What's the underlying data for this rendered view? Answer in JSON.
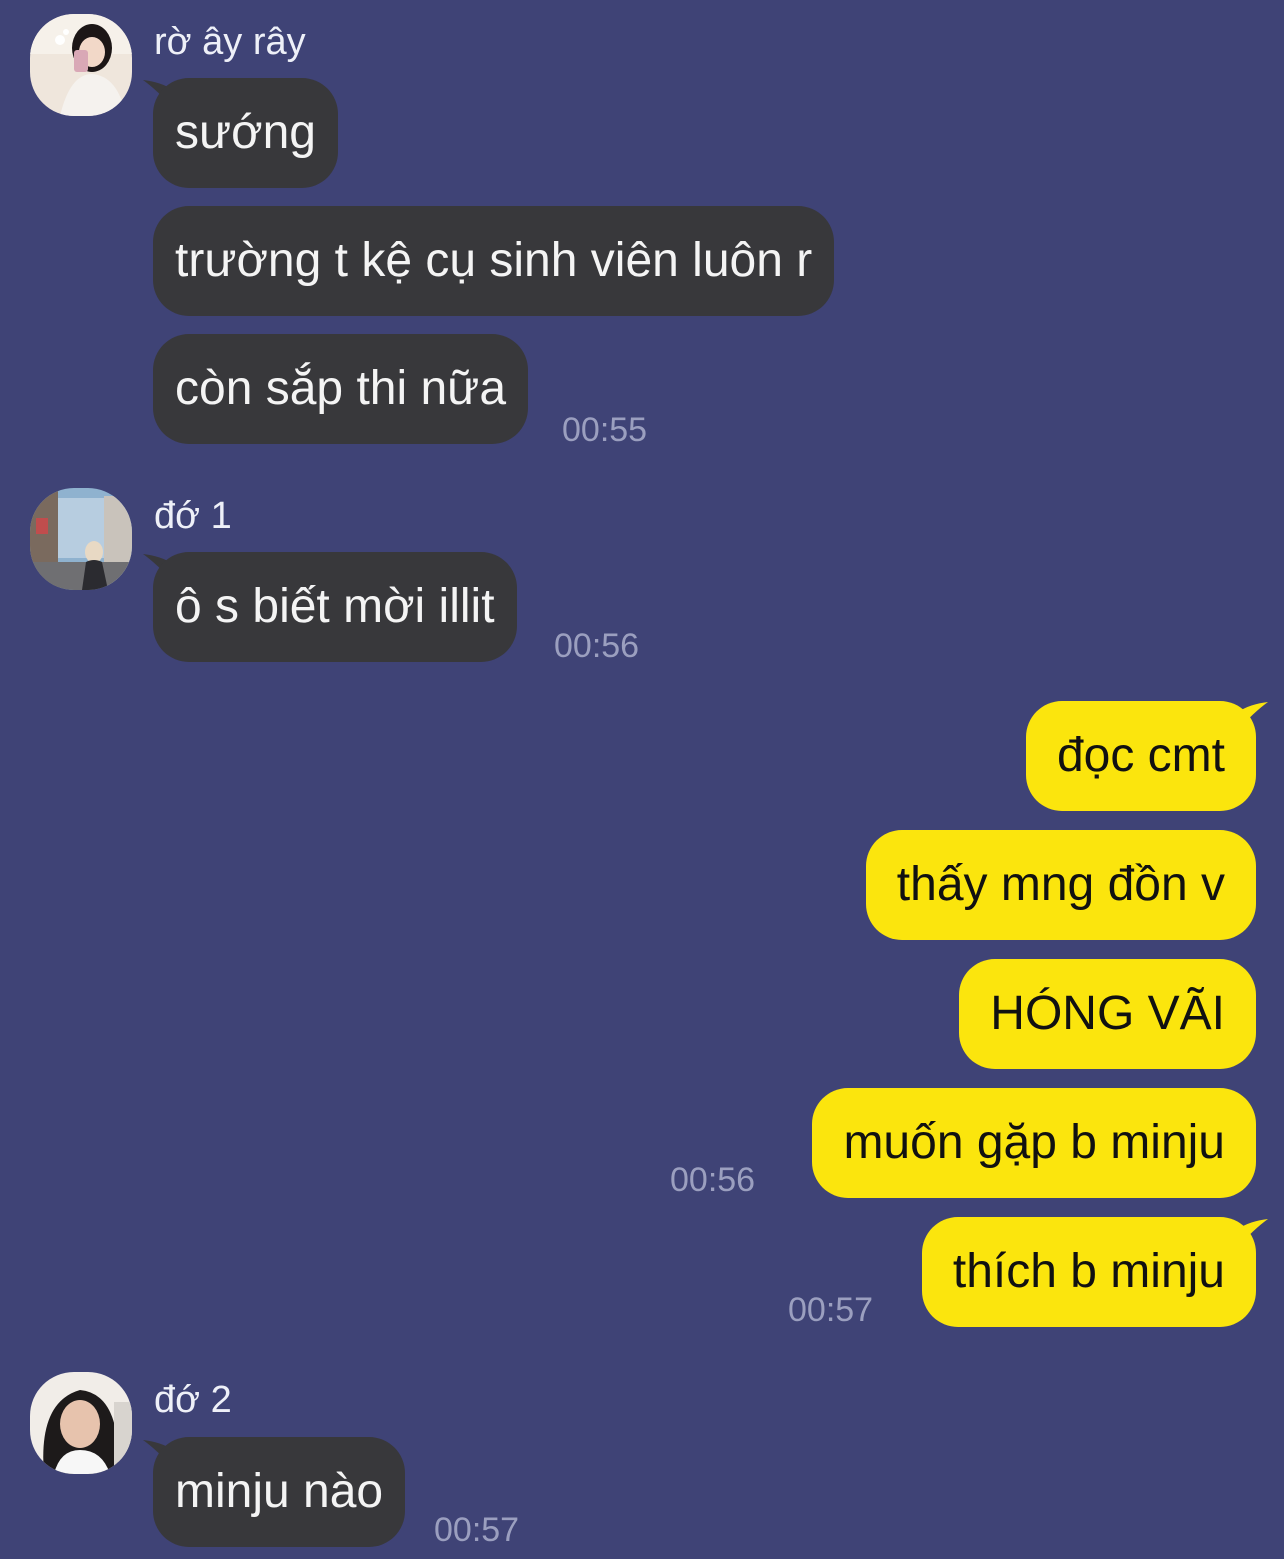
{
  "colors": {
    "background": "#3f4376",
    "incoming_bubble": "#38383b",
    "outgoing_bubble": "#fbe50d",
    "timestamp": "#9b9fbf"
  },
  "groups": [
    {
      "sender": "rờ ây rây",
      "avatar": "avatar-selfie-photo",
      "messages": [
        "sướng",
        "trường t kệ cụ sinh viên luôn r",
        "còn sắp thi nữa"
      ],
      "time": "00:55"
    },
    {
      "sender": "đớ 1",
      "avatar": "avatar-street-photo",
      "messages": [
        "ô s biết mời illit"
      ],
      "time": "00:56"
    },
    {
      "sender": "me",
      "messages": [
        "đọc cmt",
        "thấy mng đồn v",
        "HÓNG VÃI",
        "muốn gặp b minju"
      ],
      "time": "00:56"
    },
    {
      "sender": "me",
      "messages": [
        "thích b minju"
      ],
      "time": "00:57"
    },
    {
      "sender": "đớ 2",
      "avatar": "avatar-portrait-photo",
      "messages": [
        "minju nào"
      ],
      "time": "00:57"
    }
  ]
}
